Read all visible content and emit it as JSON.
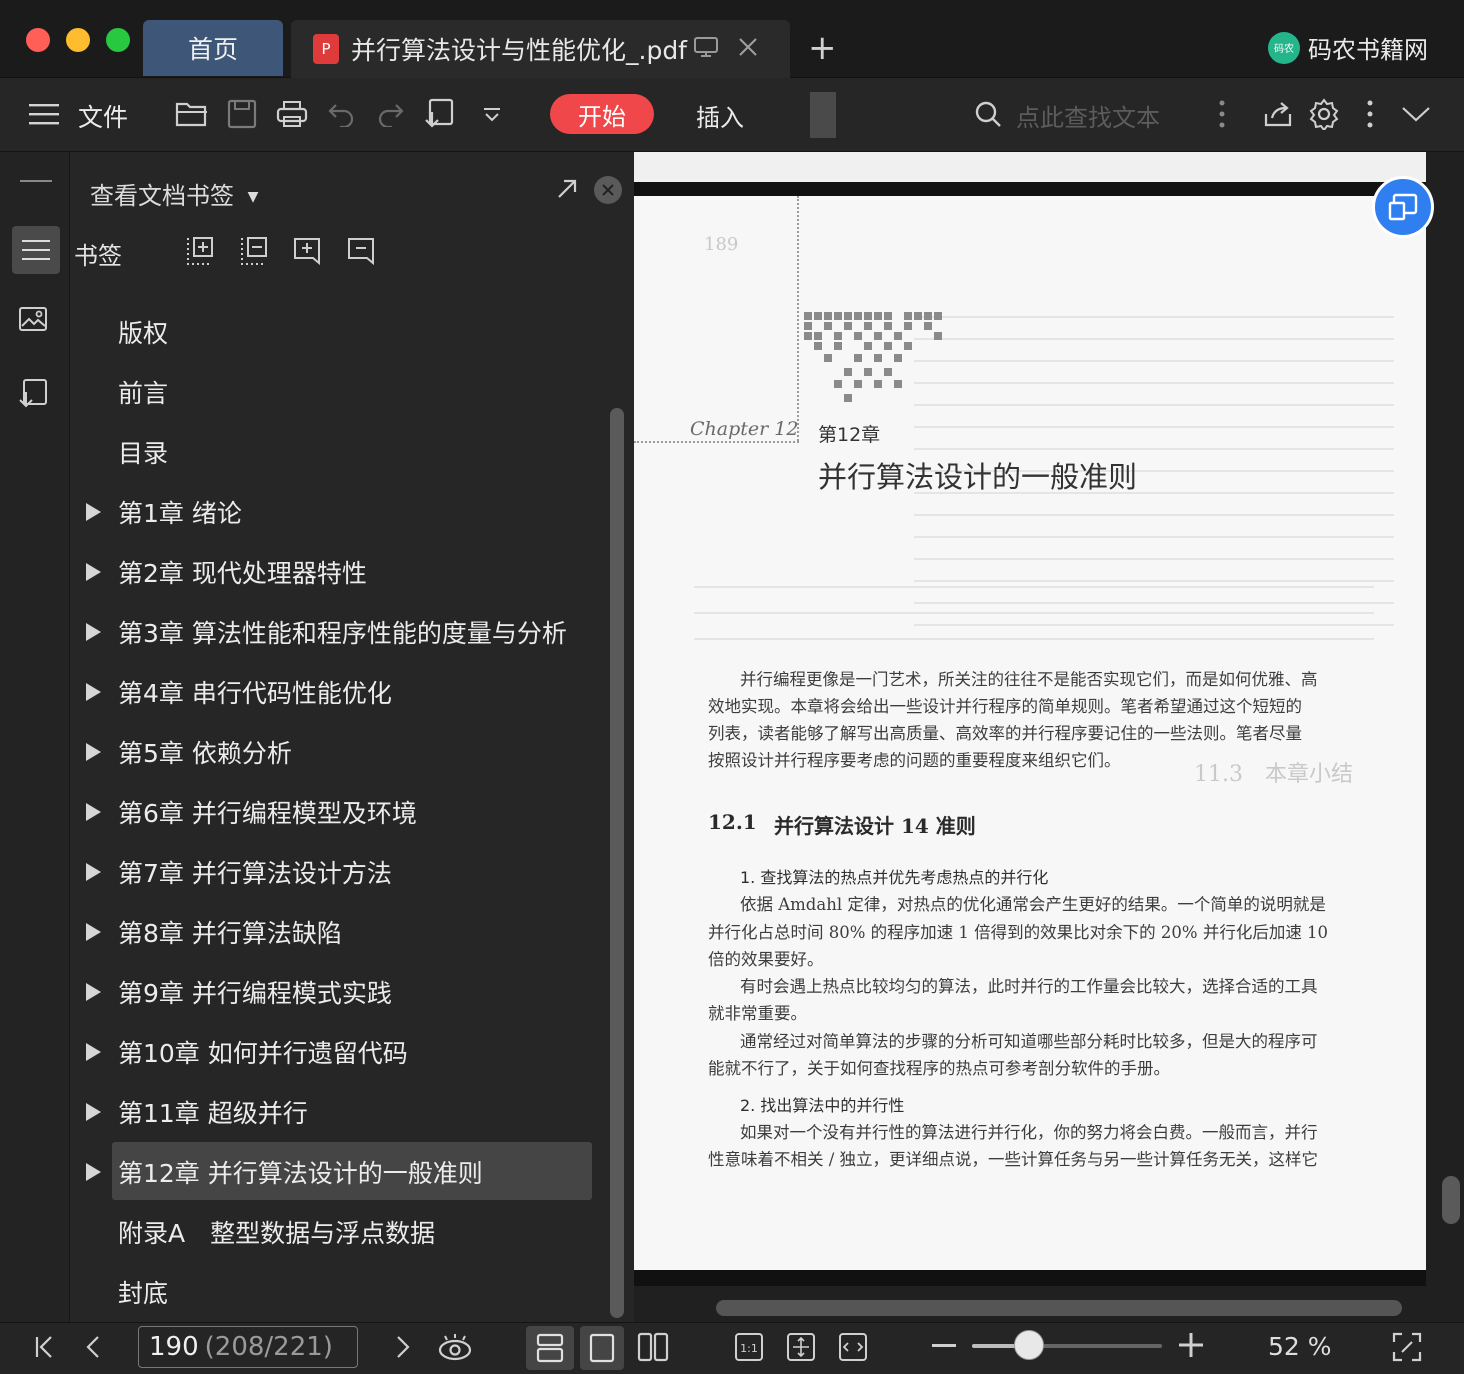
{
  "window": {
    "traffic_lights": [
      "#ff5f57",
      "#febc2e",
      "#28c840"
    ]
  },
  "tabs": {
    "home": "首页",
    "document": "并行算法设计与性能优化_.pdf",
    "new_tab": "+"
  },
  "brand": {
    "logo_text": "码农",
    "name": "码农书籍网"
  },
  "toolbar": {
    "file_label": "文件",
    "start_label": "开始",
    "insert_label": "插入",
    "search_placeholder": "点此查找文本",
    "icons": [
      "menu-icon",
      "folder-open-icon",
      "save-icon",
      "print-icon",
      "undo-icon",
      "redo-icon",
      "export-icon",
      "dropdown-icon",
      "search-icon",
      "share-icon",
      "gear-icon",
      "more-icon",
      "chevron-down-icon"
    ]
  },
  "panel": {
    "title": "查看文档书签",
    "bookmark_label": "书签",
    "items": [
      {
        "label": "版权",
        "expandable": false
      },
      {
        "label": "前言",
        "expandable": false
      },
      {
        "label": "目录",
        "expandable": false
      },
      {
        "label": "第1章 绪论",
        "expandable": true
      },
      {
        "label": "第2章 现代处理器特性",
        "expandable": true
      },
      {
        "label": "第3章 算法性能和程序性能的度量与分析",
        "expandable": true
      },
      {
        "label": "第4章 串行代码性能优化",
        "expandable": true
      },
      {
        "label": "第5章 依赖分析",
        "expandable": true
      },
      {
        "label": "第6章 并行编程模型及环境",
        "expandable": true
      },
      {
        "label": "第7章 并行算法设计方法",
        "expandable": true
      },
      {
        "label": "第8章 并行算法缺陷",
        "expandable": true
      },
      {
        "label": "第9章 并行编程模式实践",
        "expandable": true
      },
      {
        "label": "第10章 如何并行遗留代码",
        "expandable": true
      },
      {
        "label": "第11章 超级并行",
        "expandable": true
      },
      {
        "label": "第12章 并行算法设计的一般准则",
        "expandable": true,
        "selected": true
      },
      {
        "label": "附录A　整型数据与浮点数据",
        "expandable": false
      },
      {
        "label": "封底",
        "expandable": false
      }
    ]
  },
  "document": {
    "chapter_script": "Chapter 12",
    "chapter_label": "第12章",
    "chapter_title": "并行算法设计的一般准则",
    "intro": [
      "并行编程更像是一门艺术，所关注的往往不是能否实现它们，而是如何优雅、高",
      "效地实现。本章将会给出一些设计并行程序的简单规则。笔者希望通过这个短短的",
      "列表，读者能够了解写出高质量、高效率的并行程序要记住的一些法则。笔者尽量",
      "按照设计并行程序要考虑的问题的重要程度来组织它们。"
    ],
    "section_number": "12.1",
    "section_title": "并行算法设计 14 准则",
    "rule1_title": "1. 查找算法的热点并优先考虑热点的并行化",
    "rule1_paragraphs": [
      "依据 Amdahl 定律，对热点的优化通常会产生更好的结果。一个简单的说明就是",
      "并行化占总时间 80% 的程序加速 1 倍得到的效果比对余下的 20% 并行化后加速 10",
      "倍的效果要好。",
      "有时会遇上热点比较均匀的算法，此时并行的工作量会比较大，选择合适的工具",
      "就非常重要。",
      "通常经过对简单算法的步骤的分析可知道哪些部分耗时比较多，但是大的程序可",
      "能就不行了，关于如何查找程序的热点可参考剖分软件的手册。"
    ],
    "rule2_title": "2. 找出算法中的并行性",
    "rule2_paragraphs": [
      "如果对一个没有并行性的算法进行并行化，你的努力将会白费。一般而言，并行",
      "性意味着不相关 / 独立，更详细点说，一些计算任务与另一些计算任务无关，这样它"
    ],
    "ghost_lines": [
      "189",
      "11.3　本章小结"
    ]
  },
  "statusbar": {
    "current_page": "190",
    "page_info": "(208/221)",
    "zoom_fraction": 0.3,
    "zoom_label": "52 %"
  }
}
